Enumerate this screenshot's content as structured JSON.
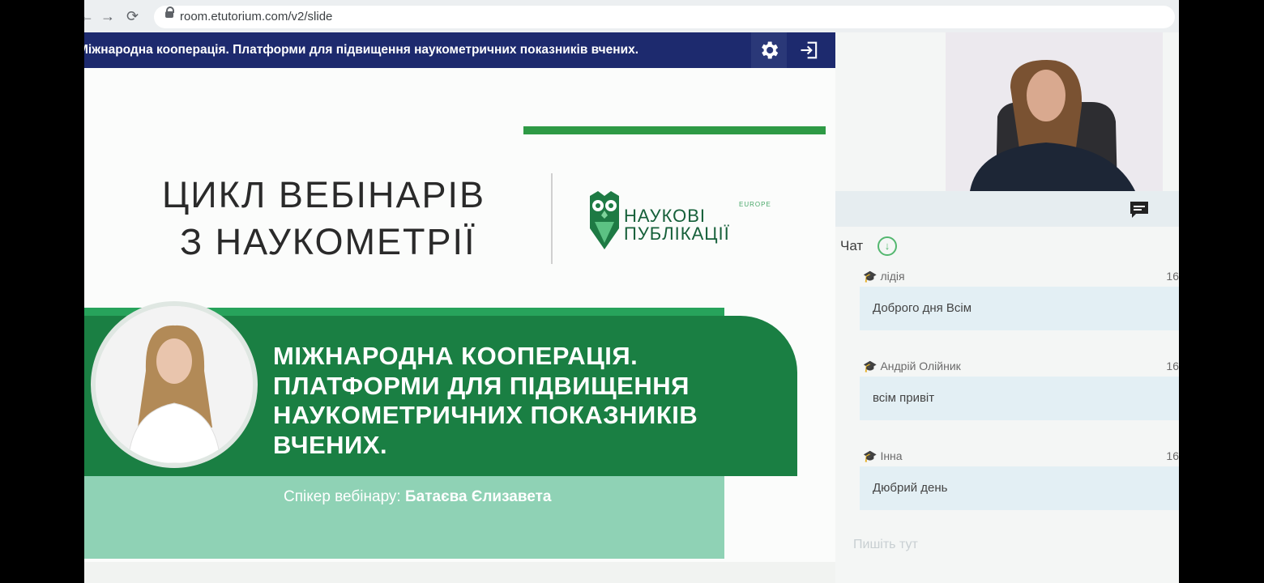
{
  "browser": {
    "url": "room.etutorium.com/v2/slide"
  },
  "slide_header": {
    "title": "Міжнародна кооперація. Платформи для підвищення наукометричних показників вчених."
  },
  "slide": {
    "series_title_line1": "ЦИКЛ ВЕБІНАРІВ",
    "series_title_line2": "З НАУКОМЕТРІЇ",
    "logo_line1": "НАУКОВІ",
    "logo_line2": "ПУБЛІКАЦІЇ",
    "logo_tag": "EUROPE",
    "webinar_title_lines": [
      "МІЖНАРОДНА КООПЕРАЦІЯ.",
      "ПЛАТФОРМИ ДЛЯ ПІДВИЩЕННЯ",
      "НАУКОМЕТРИЧНИХ ПОКАЗНИКІВ",
      "ВЧЕНИХ."
    ],
    "speaker_prefix": "Спікер вебінару:",
    "speaker_name": "Батаєва Єлизавета",
    "colors": {
      "brand_dark": "#1d2a6e",
      "green": "#1a7f43",
      "green_light": "#8fd2b5"
    }
  },
  "chat": {
    "title": "Чат",
    "messages": [
      {
        "author": "лідія",
        "time": "16",
        "text": "Доброго дня Всім"
      },
      {
        "author": "Андрій Олійник",
        "time": "16",
        "text": "всім привіт"
      },
      {
        "author": "Інна",
        "time": "16",
        "text": "Дюбрий день"
      }
    ],
    "input_placeholder": "Пишіть тут"
  },
  "icons": {
    "back": "arrow-left-icon",
    "forward": "arrow-right-icon",
    "reload": "reload-icon",
    "lock": "lock-icon",
    "settings": "gear-icon",
    "exit": "exit-icon",
    "chat_toggle": "chat-bubble-icon",
    "scroll_down": "arrow-down-circle-icon",
    "user_role": "graduation-cap-icon"
  }
}
